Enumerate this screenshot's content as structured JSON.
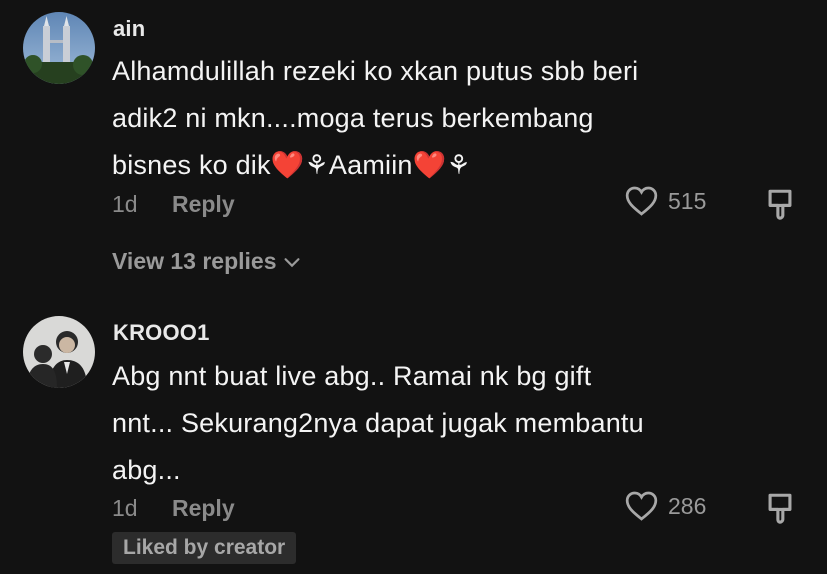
{
  "comments": [
    {
      "username": "ain",
      "text_line1": "Alhamdulillah rezeki ko xkan putus sbb beri",
      "text_line2": "adik2 ni mkn....moga terus berkembang",
      "text_line3a": "bisnes ko dik",
      "emoji_heart": "❤️",
      "emoji_sym": "⚘",
      "text_line3b": "Aamiin",
      "time": "1d",
      "reply_label": "Reply",
      "likes": "515",
      "view_replies": "View 13 replies"
    },
    {
      "username": "KROOO1",
      "text_line1": "Abg nnt buat live abg.. Ramai nk bg gift",
      "text_line2": "nnt... Sekurang2nya dapat jugak membantu",
      "text_line3": "abg...",
      "time": "1d",
      "reply_label": "Reply",
      "likes": "286",
      "liked_by": "Liked by creator"
    }
  ],
  "colors": {
    "background": "#121212",
    "text": "#f4f4f4",
    "muted": "#8a8a8a",
    "heart": "#e5202c"
  },
  "icons": [
    "avatar-ain",
    "avatar-krooo1",
    "heart-outline-icon",
    "dislike-icon",
    "chevron-down-icon"
  ]
}
